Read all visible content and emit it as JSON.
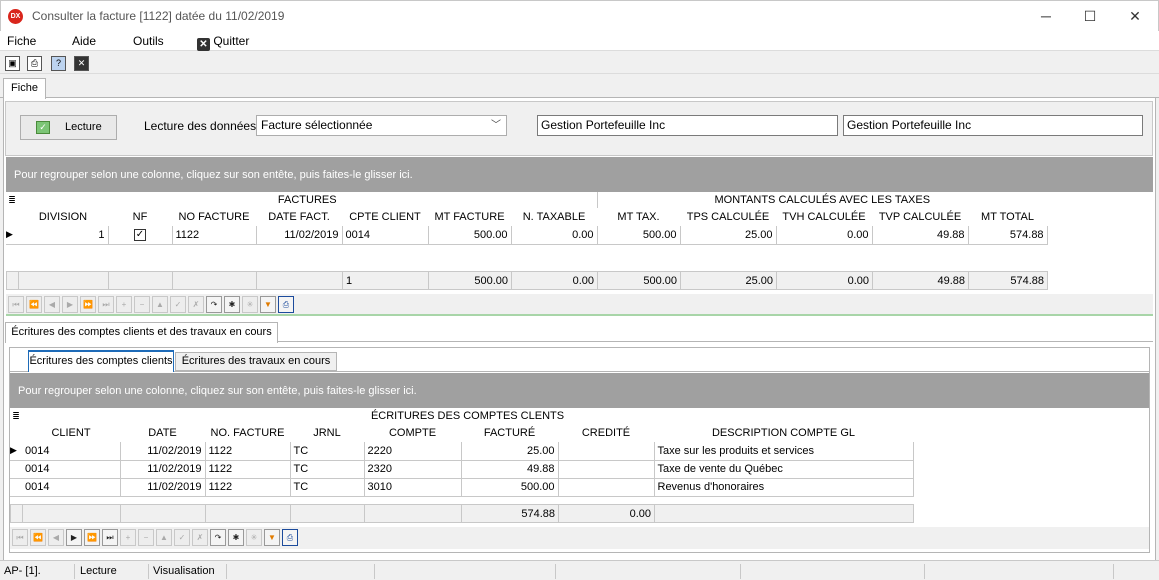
{
  "window": {
    "title": "Consulter la facture [1122] datée du 11/02/2019",
    "app_icon": "DX"
  },
  "menu": {
    "fiche": "Fiche",
    "aide": "Aide",
    "outils": "Outils",
    "quitter": "Quitter"
  },
  "tabs": {
    "fiche": "Fiche"
  },
  "lecture": {
    "button": "Lecture",
    "label": "Lecture des données :",
    "select_value": "Facture sélectionnée",
    "field1": "Gestion Portefeuille Inc",
    "field2": "Gestion Portefeuille Inc"
  },
  "factures_grid": {
    "group_hint": "Pour regrouper selon une colonne, cliquez sur son entête, puis faites-le glisser ici.",
    "band1": "FACTURES",
    "band2": "MONTANTS CALCULÉS AVEC LES TAXES",
    "columns": [
      "DIVISION",
      "NF",
      "NO FACTURE",
      "DATE FACT.",
      "CPTE CLIENT",
      "MT FACTURE",
      "N. TAXABLE",
      "MT TAX.",
      "TPS CALCULÉE",
      "TVH CALCULÉE",
      "TVP CALCULÉE",
      "MT TOTAL"
    ],
    "row": {
      "division": "1",
      "nf_checked": true,
      "no_facture": "1122",
      "date": "11/02/2019",
      "cpte": "0014",
      "mt_facture": "500.00",
      "n_taxable": "0.00",
      "mt_tax": "500.00",
      "tps": "25.00",
      "tvh": "0.00",
      "tvp": "49.88",
      "mt_total": "574.88"
    },
    "footer": {
      "count": "1",
      "mt_facture": "500.00",
      "n_taxable": "0.00",
      "mt_tax": "500.00",
      "tps": "25.00",
      "tvh": "0.00",
      "tvp": "49.88",
      "mt_total": "574.88"
    }
  },
  "subtabs": {
    "ecritures": "Écritures des comptes clients et des travaux en cours"
  },
  "inner_tabs": {
    "clients": "Écritures des comptes clients",
    "travaux": "Écritures des travaux en cours"
  },
  "ecritures_grid": {
    "group_hint": "Pour regrouper selon une colonne, cliquez sur son entête, puis faites-le glisser ici.",
    "band": "ÉCRITURES DES COMPTES CLENTS",
    "columns": [
      "CLIENT",
      "DATE",
      "NO. FACTURE",
      "JRNL",
      "COMPTE",
      "FACTURÉ",
      "CREDITÉ",
      "DESCRIPTION COMPTE GL"
    ],
    "rows": [
      {
        "client": "0014",
        "date": "11/02/2019",
        "no": "1122",
        "jrnl": "TC",
        "compte": "2220",
        "facture": "25.00",
        "credite": "",
        "desc": "Taxe sur les produits et services"
      },
      {
        "client": "0014",
        "date": "11/02/2019",
        "no": "1122",
        "jrnl": "TC",
        "compte": "2320",
        "facture": "49.88",
        "credite": "",
        "desc": "Taxe de vente du Québec"
      },
      {
        "client": "0014",
        "date": "11/02/2019",
        "no": "1122",
        "jrnl": "TC",
        "compte": "3010",
        "facture": "500.00",
        "credite": "",
        "desc": "Revenus d'honoraires"
      }
    ],
    "footer": {
      "facture": "574.88",
      "credite": "0.00"
    }
  },
  "status": {
    "s1": "AP- [1].",
    "s2": "Lecture",
    "s3": "Visualisation"
  }
}
